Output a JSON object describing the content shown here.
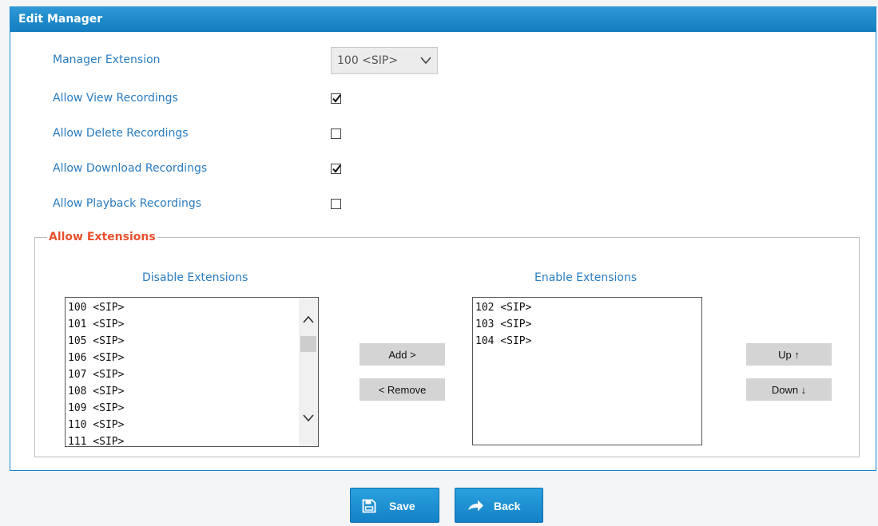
{
  "header": {
    "title": "Edit Manager"
  },
  "form": {
    "manager_extension_label": "Manager Extension",
    "manager_extension_value": "100 <SIP>",
    "allow_view_label": "Allow View Recordings",
    "allow_view_checked": true,
    "allow_delete_label": "Allow Delete Recordings",
    "allow_delete_checked": false,
    "allow_download_label": "Allow Download Recordings",
    "allow_download_checked": true,
    "allow_playback_label": "Allow Playback Recordings",
    "allow_playback_checked": false
  },
  "extensions": {
    "legend": "Allow Extensions",
    "disable_title": "Disable Extensions",
    "enable_title": "Enable Extensions",
    "disabled": [
      "100 <SIP>",
      "101 <SIP>",
      "105 <SIP>",
      "106 <SIP>",
      "107 <SIP>",
      "108 <SIP>",
      "109 <SIP>",
      "110 <SIP>",
      "111 <SIP>"
    ],
    "enabled": [
      "102 <SIP>",
      "103 <SIP>",
      "104 <SIP>"
    ],
    "add_label": "Add >",
    "remove_label": "< Remove",
    "up_label": "Up ↑",
    "down_label": "Down ↓"
  },
  "actions": {
    "save_label": "Save",
    "save_icon": "save-icon",
    "back_label": "Back",
    "back_icon": "back-arrow-icon"
  },
  "colors": {
    "accent": "#1b86c8",
    "label": "#2a7cc0",
    "legend": "#e8502f"
  }
}
